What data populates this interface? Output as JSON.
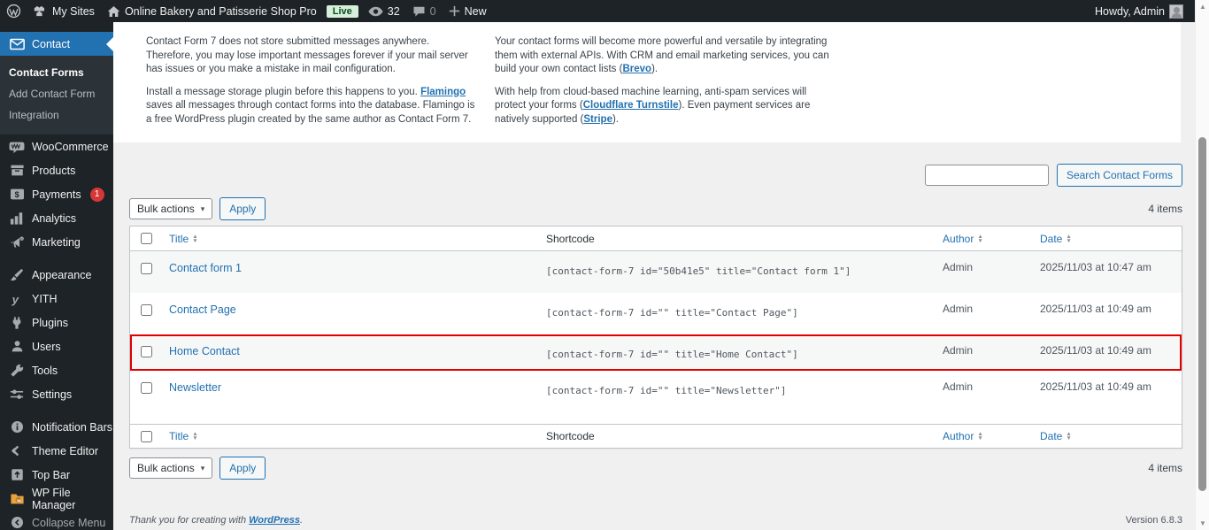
{
  "colors": {
    "admin_bar_bg": "#1d2327",
    "accent_blue": "#2271b1",
    "highlight_red": "#e10000",
    "badge_red": "#d63638",
    "live_badge_bg": "#d5efdb",
    "content_bg": "#f0f0f1"
  },
  "admin_bar": {
    "my_sites": "My Sites",
    "site_name": "Online Bakery and Patisserie Shop Pro",
    "live": "Live",
    "views": "32",
    "comments": "0",
    "new": "New",
    "howdy": "Howdy, Admin"
  },
  "sidebar": {
    "contact": {
      "label": "Contact",
      "submenu": [
        {
          "label": "Contact Forms",
          "current": true
        },
        {
          "label": "Add Contact Form",
          "current": false
        },
        {
          "label": "Integration",
          "current": false
        }
      ]
    },
    "items": [
      {
        "label": "WooCommerce",
        "icon": "woocommerce-icon"
      },
      {
        "label": "Products",
        "icon": "products-icon"
      },
      {
        "label": "Payments",
        "icon": "payments-icon",
        "badge": "1"
      },
      {
        "label": "Analytics",
        "icon": "analytics-icon"
      },
      {
        "label": "Marketing",
        "icon": "marketing-icon"
      },
      {
        "label": "Appearance",
        "icon": "appearance-icon"
      },
      {
        "label": "YITH",
        "icon": "yith-icon"
      },
      {
        "label": "Plugins",
        "icon": "plugins-icon"
      },
      {
        "label": "Users",
        "icon": "users-icon"
      },
      {
        "label": "Tools",
        "icon": "tools-icon"
      },
      {
        "label": "Settings",
        "icon": "settings-icon"
      },
      {
        "label": "Notification Bars",
        "icon": "notification-bars-icon"
      },
      {
        "label": "Theme Editor",
        "icon": "theme-editor-icon"
      },
      {
        "label": "Top Bar",
        "icon": "top-bar-icon"
      },
      {
        "label": "WP File Manager",
        "icon": "wp-file-manager-icon"
      },
      {
        "label": "Collapse Menu",
        "icon": "collapse-menu-icon"
      }
    ]
  },
  "info_panel": {
    "left": {
      "p1": "Contact Form 7 does not store submitted messages anywhere. Therefore, you may lose important messages forever if your mail server has issues or you make a mistake in mail configuration.",
      "p2_pre": "Install a message storage plugin before this happens to you. ",
      "p2_link": "Flamingo",
      "p2_post": " saves all messages through contact forms into the database. Flamingo is a free WordPress plugin created by the same author as Contact Form 7."
    },
    "right": {
      "p1_pre": "Your contact forms will become more powerful and versatile by integrating them with external APIs. With CRM and email marketing services, you can build your own contact lists (",
      "p1_link": "Brevo",
      "p1_post": ").",
      "p2_pre": "With help from cloud-based machine learning, anti-spam services will protect your forms (",
      "p2_link": "Cloudflare Turnstile",
      "p2_mid": "). Even payment services are natively supported (",
      "p2_link2": "Stripe",
      "p2_post": ")."
    }
  },
  "toolbar": {
    "search_button": "Search Contact Forms",
    "bulk_actions": "Bulk actions",
    "apply": "Apply",
    "items_count": "4 items"
  },
  "table": {
    "headers": {
      "title": "Title",
      "shortcode": "Shortcode",
      "author": "Author",
      "date": "Date"
    },
    "rows": [
      {
        "title": "Contact form 1",
        "shortcode": "[contact-form-7 id=\"50b41e5\" title=\"Contact form 1\"]",
        "author": "Admin",
        "date": "2025/11/03 at 10:47 am",
        "highlighted": false
      },
      {
        "title": "Contact Page",
        "shortcode": "[contact-form-7 id=\"\" title=\"Contact Page\"]",
        "author": "Admin",
        "date": "2025/11/03 at 10:49 am",
        "highlighted": false
      },
      {
        "title": "Home Contact",
        "shortcode": "[contact-form-7 id=\"\" title=\"Home Contact\"]",
        "author": "Admin",
        "date": "2025/11/03 at 10:49 am",
        "highlighted": true
      },
      {
        "title": "Newsletter",
        "shortcode": "[contact-form-7 id=\"\" title=\"Newsletter\"]",
        "author": "Admin",
        "date": "2025/11/03 at 10:49 am",
        "highlighted": false
      }
    ]
  },
  "footer": {
    "thanks_pre": "Thank you for creating with ",
    "thanks_link": "WordPress",
    "thanks_post": ".",
    "version": "Version 6.8.3"
  }
}
